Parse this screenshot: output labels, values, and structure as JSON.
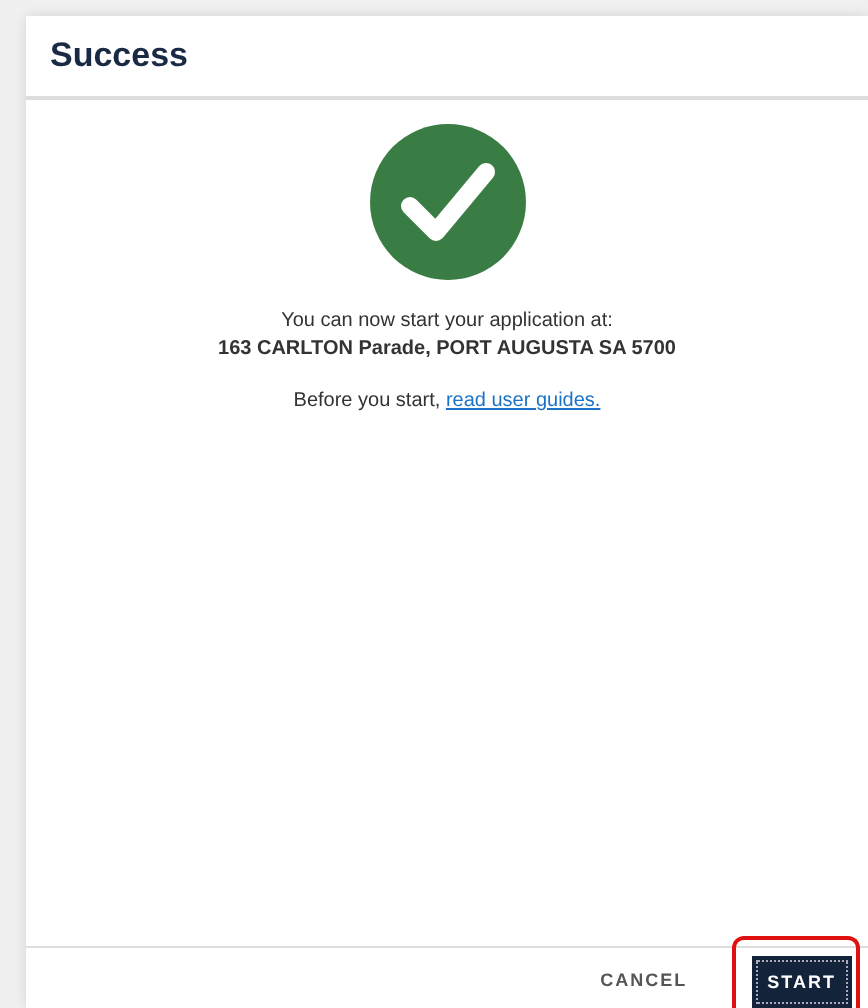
{
  "dialog": {
    "title": "Success",
    "message": "You can now start your application at:",
    "address": "163 CARLTON Parade, PORT AUGUSTA SA 5700",
    "note": "Before you start, ",
    "link": "read user guides.",
    "buttons": [
      {
        "label": "CANCEL",
        "kind": "text",
        "highlighted": false
      },
      {
        "label": "START",
        "kind": "primary",
        "highlighted": true
      }
    ]
  }
}
